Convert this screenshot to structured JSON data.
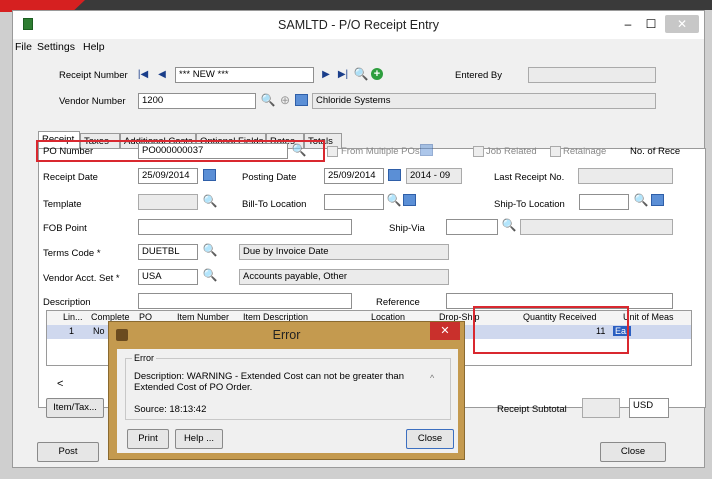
{
  "window": {
    "title": "SAMLTD - P/O Receipt Entry",
    "min_glyph": "–",
    "max_glyph": "☐",
    "close_glyph": "✕"
  },
  "menu": {
    "items": [
      "File",
      "Settings",
      "Help"
    ]
  },
  "header": {
    "receipt_number_label": "Receipt Number",
    "receipt_number_value": "*** NEW ***",
    "entered_by_label": "Entered By",
    "entered_by_value": "",
    "vendor_number_label": "Vendor Number",
    "vendor_number_value": "1200",
    "vendor_name_value": "Chloride Systems"
  },
  "tabs": [
    "Receipt",
    "Taxes",
    "Additional Costs",
    "Optional Fields",
    "Rates",
    "Totals"
  ],
  "form": {
    "po_number_label": "PO Number",
    "po_number_value": "PO000000037",
    "from_multiple_label": "From Multiple POs",
    "job_related_label": "Job Related",
    "retainage_label": "Retainage",
    "no_of_receipts_label": "No. of Rece",
    "receipt_date_label": "Receipt Date",
    "receipt_date_value": "25/09/2014",
    "posting_date_label": "Posting Date",
    "posting_date_value": "25/09/2014",
    "period_value": "2014 - 09",
    "last_receipt_label": "Last Receipt No.",
    "template_label": "Template",
    "bill_to_label": "Bill-To Location",
    "ship_to_label": "Ship-To Location",
    "fob_label": "FOB Point",
    "ship_via_label": "Ship-Via",
    "terms_label": "Terms Code *",
    "terms_value": "DUETBL",
    "terms_desc": "Due by Invoice Date",
    "vendor_acct_label": "Vendor Acct. Set *",
    "vendor_acct_value": "USA",
    "vendor_acct_desc": "Accounts payable, Other",
    "description_label": "Description",
    "reference_label": "Reference"
  },
  "grid": {
    "headers": [
      "Lin...",
      "Complete",
      "PO",
      "Item Number",
      "Item Description",
      "Location",
      "Drop-Ship",
      "Quantity Received",
      "Unit of Meas"
    ],
    "row": {
      "line": "1",
      "complete": "No",
      "quantity": "11",
      "uom": "Ea."
    }
  },
  "footer": {
    "item_tax_label": "Item/Tax...",
    "receipt_subtotal_label": "Receipt Subtotal",
    "currency": "USD",
    "post_label": "Post",
    "close_label": "Close"
  },
  "dialog": {
    "title": "Error",
    "group_label": "Error",
    "description": "Description: WARNING - Extended Cost can not be greater than Extended Cost of PO Order.",
    "source": "Source: 18:13:42",
    "print_label": "Print",
    "help_label": "Help ...",
    "close_label": "Close",
    "close_glyph": "✕"
  }
}
